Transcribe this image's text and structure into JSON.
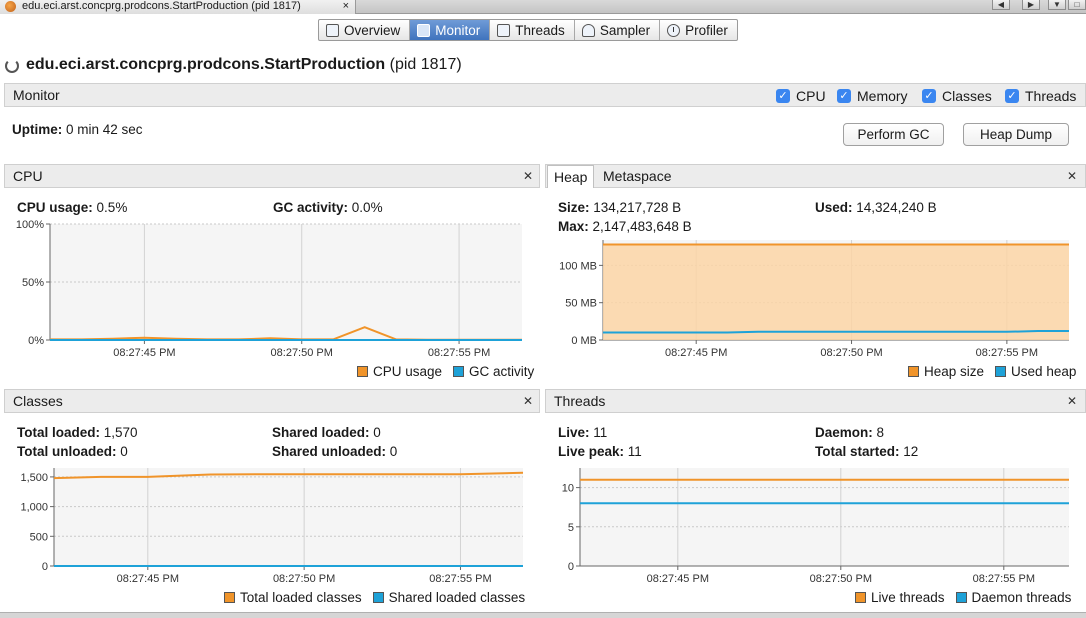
{
  "window": {
    "doc_tab_title": "edu.eci.arst.concprg.prodcons.StartProduction (pid 1817)",
    "close_glyph": "×"
  },
  "tabs": [
    {
      "label": "Overview",
      "icon": "overview-icon"
    },
    {
      "label": "Monitor",
      "icon": "monitor-icon",
      "active": true
    },
    {
      "label": "Threads",
      "icon": "threads-icon"
    },
    {
      "label": "Sampler",
      "icon": "sampler-icon"
    },
    {
      "label": "Profiler",
      "icon": "profiler-icon"
    }
  ],
  "header": {
    "app_name": "edu.eci.arst.concprg.prodcons.StartProduction",
    "pid": "(pid 1817)"
  },
  "monitor": {
    "label": "Monitor",
    "checkboxes": [
      {
        "label": "CPU",
        "checked": true
      },
      {
        "label": "Memory",
        "checked": true
      },
      {
        "label": "Classes",
        "checked": true
      },
      {
        "label": "Threads",
        "checked": true
      }
    ],
    "uptime_label": "Uptime:",
    "uptime_value": "0 min 42 sec",
    "perform_gc": "Perform GC",
    "heap_dump": "Heap Dump"
  },
  "cpu_panel": {
    "title": "CPU",
    "cpu_usage_label": "CPU usage:",
    "cpu_usage_value": "0.5%",
    "gc_activity_label": "GC activity:",
    "gc_activity_value": "0.0%",
    "legend": [
      "CPU usage",
      "GC activity"
    ]
  },
  "heap_panel": {
    "tabs": [
      "Heap",
      "Metaspace"
    ],
    "size_label": "Size:",
    "size_value": "134,217,728 B",
    "used_label": "Used:",
    "used_value": "14,324,240 B",
    "max_label": "Max:",
    "max_value": "2,147,483,648 B",
    "legend": [
      "Heap size",
      "Used heap"
    ]
  },
  "classes_panel": {
    "title": "Classes",
    "total_loaded_label": "Total loaded:",
    "total_loaded_value": "1,570",
    "shared_loaded_label": "Shared loaded:",
    "shared_loaded_value": "0",
    "total_unloaded_label": "Total unloaded:",
    "total_unloaded_value": "0",
    "shared_unloaded_label": "Shared unloaded:",
    "shared_unloaded_value": "0",
    "legend": [
      "Total loaded classes",
      "Shared loaded classes"
    ]
  },
  "threads_panel": {
    "title": "Threads",
    "live_label": "Live:",
    "live_value": "11",
    "daemon_label": "Daemon:",
    "daemon_value": "8",
    "live_peak_label": "Live peak:",
    "live_peak_value": "11",
    "total_started_label": "Total started:",
    "total_started_value": "12",
    "legend": [
      "Live threads",
      "Daemon threads"
    ]
  },
  "colors": {
    "series_orange": "#f0942a",
    "series_blue": "#1ea2d8",
    "area_fill": "#fbd5a6"
  },
  "chart_data": [
    {
      "id": "cpu",
      "type": "line",
      "x_ticks": [
        "08:27:45 PM",
        "08:27:50 PM",
        "08:27:55 PM"
      ],
      "y_ticks": [
        "100%",
        "50%",
        "0%"
      ],
      "ylim": [
        0,
        100
      ],
      "x": [
        0,
        2,
        4,
        6,
        8,
        10,
        12,
        14,
        16,
        18,
        20,
        22,
        24,
        26,
        28,
        30
      ],
      "series": [
        {
          "name": "CPU usage",
          "color": "#f0942a",
          "values": [
            0.5,
            0.5,
            1,
            2,
            1,
            0.5,
            0.5,
            1.5,
            0.5,
            0.5,
            11,
            0.5,
            0.3,
            0.3,
            0.3,
            0.3
          ]
        },
        {
          "name": "GC activity",
          "color": "#1ea2d8",
          "values": [
            0,
            0,
            0,
            0,
            0,
            0,
            0,
            0,
            0,
            0,
            0,
            0,
            0,
            0,
            0,
            0
          ]
        }
      ]
    },
    {
      "id": "heap",
      "type": "area",
      "x_ticks": [
        "08:27:45 PM",
        "08:27:50 PM",
        "08:27:55 PM"
      ],
      "y_ticks": [
        "100 MB",
        "50 MB",
        "0 MB"
      ],
      "ylim": [
        0,
        134
      ],
      "x": [
        0,
        4,
        8,
        10,
        14,
        18,
        22,
        26,
        28,
        30
      ],
      "series": [
        {
          "name": "Heap size",
          "color": "#f0942a",
          "values": [
            128,
            128,
            128,
            128,
            128,
            128,
            128,
            128,
            128,
            128
          ]
        },
        {
          "name": "Used heap",
          "color": "#1ea2d8",
          "values": [
            10,
            10,
            10,
            11,
            11,
            11,
            11,
            11,
            12,
            12
          ]
        }
      ]
    },
    {
      "id": "classes",
      "type": "line",
      "x_ticks": [
        "08:27:45 PM",
        "08:27:50 PM",
        "08:27:55 PM"
      ],
      "y_ticks": [
        "1,500",
        "1,000",
        "500",
        "0"
      ],
      "ylim": [
        0,
        1650
      ],
      "x": [
        0,
        3,
        6,
        10,
        14,
        18,
        22,
        26,
        30
      ],
      "series": [
        {
          "name": "Total loaded classes",
          "color": "#f0942a",
          "values": [
            1480,
            1500,
            1500,
            1540,
            1545,
            1545,
            1545,
            1545,
            1570
          ]
        },
        {
          "name": "Shared loaded classes",
          "color": "#1ea2d8",
          "values": [
            0,
            0,
            0,
            0,
            0,
            0,
            0,
            0,
            0
          ]
        }
      ]
    },
    {
      "id": "threads",
      "type": "line",
      "x_ticks": [
        "08:27:45 PM",
        "08:27:50 PM",
        "08:27:55 PM"
      ],
      "y_ticks": [
        "10",
        "5",
        "0"
      ],
      "ylim": [
        0,
        12.5
      ],
      "x": [
        0,
        30
      ],
      "series": [
        {
          "name": "Live threads",
          "color": "#f0942a",
          "values": [
            11,
            11
          ]
        },
        {
          "name": "Daemon threads",
          "color": "#1ea2d8",
          "values": [
            8,
            8
          ]
        }
      ]
    }
  ]
}
